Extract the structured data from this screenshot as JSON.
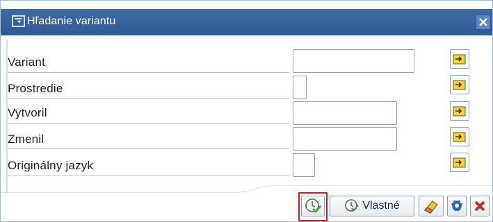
{
  "window": {
    "title": "Hľadanie variantu"
  },
  "fields": [
    {
      "label": "Variant",
      "value": ""
    },
    {
      "label": "Prostredie",
      "value": ""
    },
    {
      "label": "Vytvoril",
      "value": ""
    },
    {
      "label": "Zmenil",
      "value": ""
    },
    {
      "label": "Originálny jazyk",
      "value": ""
    }
  ],
  "toolbar": {
    "own_label": "Vlastné"
  },
  "icons": {
    "title": "dialog-icon",
    "close": "close-icon",
    "multi_select": "arrow-right-yellow-icon",
    "execute": "execute-clock-icon",
    "own": "execute-clock-icon",
    "delete": "eraser-icon",
    "settings": "gear-icon",
    "cancel": "cancel-x-icon"
  },
  "colors": {
    "title_bar": "#2d5a95",
    "highlight": "#d81e1e",
    "yellow_button": "#f4cf43"
  }
}
